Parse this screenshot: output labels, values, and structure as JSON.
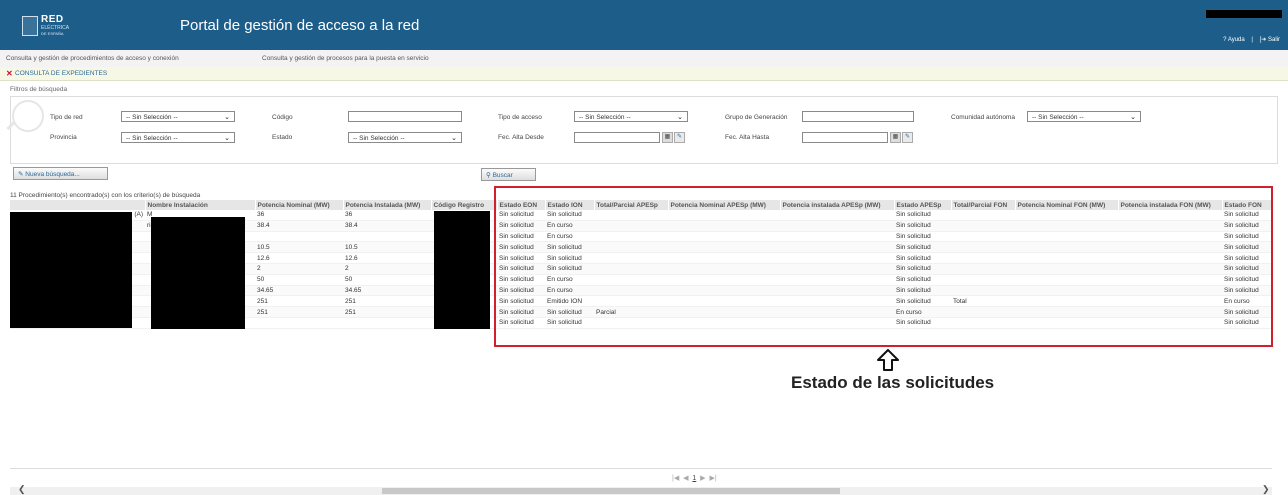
{
  "header": {
    "logo": {
      "line1": "RED",
      "line2": "ELÉCTRICA",
      "line3": "DE ESPAÑA"
    },
    "title": "Portal de gestión de acceso a la red",
    "help_label": "? Ayuda",
    "separator": "|",
    "exit_label": "[➔ Salir"
  },
  "nav": {
    "items": [
      "Consulta y gestión de procedimientos de acceso y conexión",
      "Consulta y gestión de procesos para la puesta en servicio"
    ]
  },
  "section": {
    "title": "CONSULTA DE EXPEDIENTES"
  },
  "filters": {
    "heading": "Filtros de búsqueda",
    "tipo_red": {
      "label": "Tipo de red",
      "value": "-- Sin Selección --"
    },
    "codigo": {
      "label": "Código",
      "value": ""
    },
    "tipo_acceso": {
      "label": "Tipo de acceso",
      "value": "-- Sin Selección --"
    },
    "grupo_generacion": {
      "label": "Grupo de Generación",
      "value": ""
    },
    "comunidad": {
      "label": "Comunidad autónoma",
      "value": "-- Sin Selección --"
    },
    "provincia": {
      "label": "Provincia",
      "value": "-- Sin Selección --"
    },
    "estado": {
      "label": "Estado",
      "value": "-- Sin Selección --"
    },
    "fec_desde": {
      "label": "Fec. Alta Desde",
      "value": ""
    },
    "fec_hasta": {
      "label": "Fec. Alta Hasta",
      "value": ""
    }
  },
  "actions": {
    "new_search": "Nueva búsqueda...",
    "search": "Buscar"
  },
  "results": {
    "summary": "11 Procedimiento(s) encontrado(s) con los criterio(s) de búsqueda",
    "columns": [
      "",
      "Nombre Instalación",
      "Potencia Nominal (MW)",
      "Potencia Instalada (MW)",
      "Código Registro",
      "Estado EON",
      "Estado ION",
      "Total/Parcial APESp",
      "Potencia Nominal APESp (MW)",
      "Potencia instalada APESp (MW)",
      "Estado APESp",
      "Total/Parcial FON",
      "Potencia Nominal FON (MW)",
      "Potencia instalada FON (MW)",
      "Estado FON"
    ],
    "rows": [
      [
        "(A)",
        "M",
        "36",
        "36",
        "",
        "Sin solicitud",
        "Sin solicitud",
        "",
        "",
        "",
        "Sin solicitud",
        "",
        "",
        "",
        "Sin solicitud"
      ],
      [
        "",
        "rio",
        "38.4",
        "38.4",
        "",
        "Sin solicitud",
        "En curso",
        "",
        "",
        "",
        "Sin solicitud",
        "",
        "",
        "",
        "Sin solicitud"
      ],
      [
        "",
        "",
        "",
        "",
        "",
        "Sin solicitud",
        "En curso",
        "",
        "",
        "",
        "Sin solicitud",
        "",
        "",
        "",
        "Sin solicitud"
      ],
      [
        "",
        "",
        "10.5",
        "10.5",
        "",
        "Sin solicitud",
        "Sin solicitud",
        "",
        "",
        "",
        "Sin solicitud",
        "",
        "",
        "",
        "Sin solicitud"
      ],
      [
        "",
        "",
        "12.6",
        "12.6",
        "",
        "Sin solicitud",
        "Sin solicitud",
        "",
        "",
        "",
        "Sin solicitud",
        "",
        "",
        "",
        "Sin solicitud"
      ],
      [
        "",
        "",
        "2",
        "2",
        "",
        "Sin solicitud",
        "Sin solicitud",
        "",
        "",
        "",
        "Sin solicitud",
        "",
        "",
        "",
        "Sin solicitud"
      ],
      [
        "",
        "",
        "50",
        "50",
        "",
        "Sin solicitud",
        "En curso",
        "",
        "",
        "",
        "Sin solicitud",
        "",
        "",
        "",
        "Sin solicitud"
      ],
      [
        "",
        "",
        "34.65",
        "34.65",
        "",
        "Sin solicitud",
        "En curso",
        "",
        "",
        "",
        "Sin solicitud",
        "",
        "",
        "",
        "Sin solicitud"
      ],
      [
        "",
        "",
        "251",
        "251",
        "",
        "Sin solicitud",
        "Emitido ION",
        "",
        "",
        "",
        "Sin solicitud",
        "Total",
        "",
        "",
        "En curso"
      ],
      [
        "",
        "",
        "251",
        "251",
        "",
        "Sin solicitud",
        "Sin solicitud",
        "Parcial",
        "",
        "",
        "En curso",
        "",
        "",
        "",
        "Sin solicitud"
      ],
      [
        "",
        "",
        "",
        "",
        "",
        "Sin solicitud",
        "Sin solicitud",
        "",
        "",
        "",
        "Sin solicitud",
        "",
        "",
        "",
        "Sin solicitud"
      ]
    ]
  },
  "annotation": {
    "text": "Estado de las solicitudes",
    "color": "#d0202e"
  },
  "pager": {
    "first": "|◀",
    "prev": "◀",
    "current": "1",
    "next": "▶",
    "last": "▶|"
  },
  "colors": {
    "header_bg": "#1d5d8a",
    "highlight": "#d0202e",
    "link": "#2a6a9a"
  }
}
